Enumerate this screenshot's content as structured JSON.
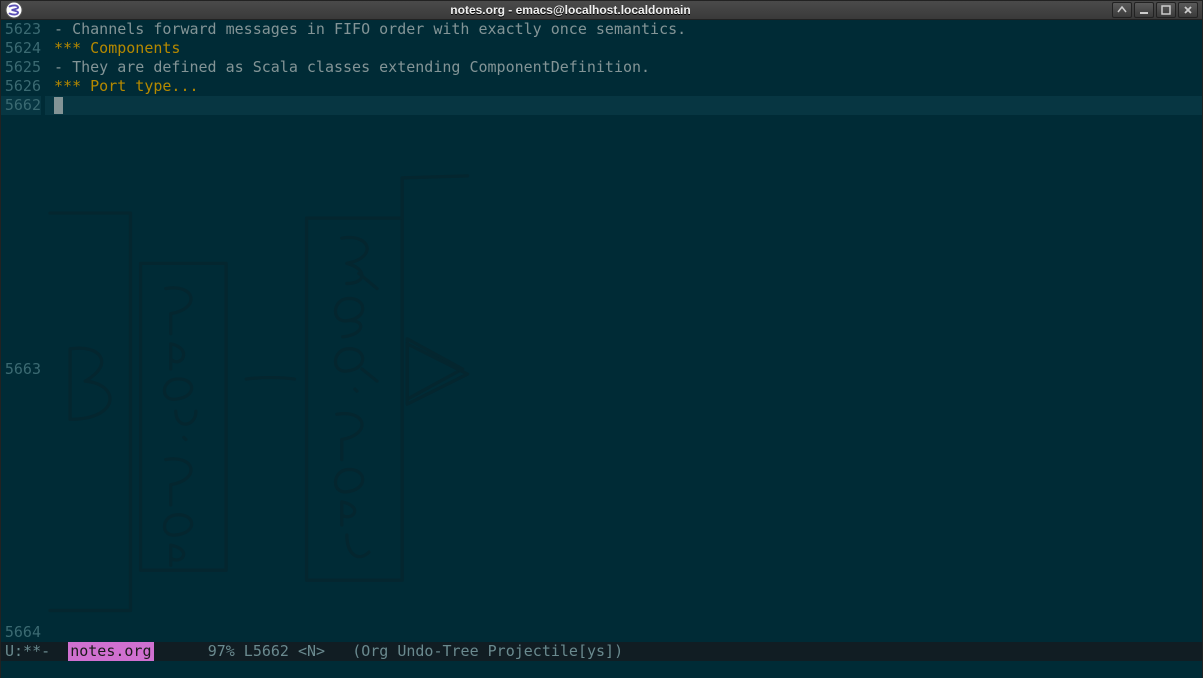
{
  "window": {
    "title": "notes.org - emacs@localhost.localdomain"
  },
  "lines": {
    "l5623_num": "5623",
    "l5623_text": " - Channels forward messages in FIFO order with exactly once semantics.",
    "l5624_num": "5624",
    "l5624_text": " *** Components",
    "l5625_num": "5625",
    "l5625_text": " - They are defined as Scala classes extending ComponentDefinition.",
    "l5626_num": "5626",
    "l5626_text": " *** Port type...",
    "l5662_num": "5662",
    "l5663_num": "5663",
    "l5664_num": "5664"
  },
  "modeline": {
    "left": "U:**-  ",
    "bufname": "notes.org",
    "gap": "      ",
    "pos": "97% L5662 ",
    "state": "<N>   ",
    "modes": "(Org Undo-Tree Projectile[ys])"
  },
  "sketch": {
    "label_left": "B",
    "label_mid": "Prov. Port",
    "label_right": "Req. Port",
    "shape_right": "A"
  }
}
